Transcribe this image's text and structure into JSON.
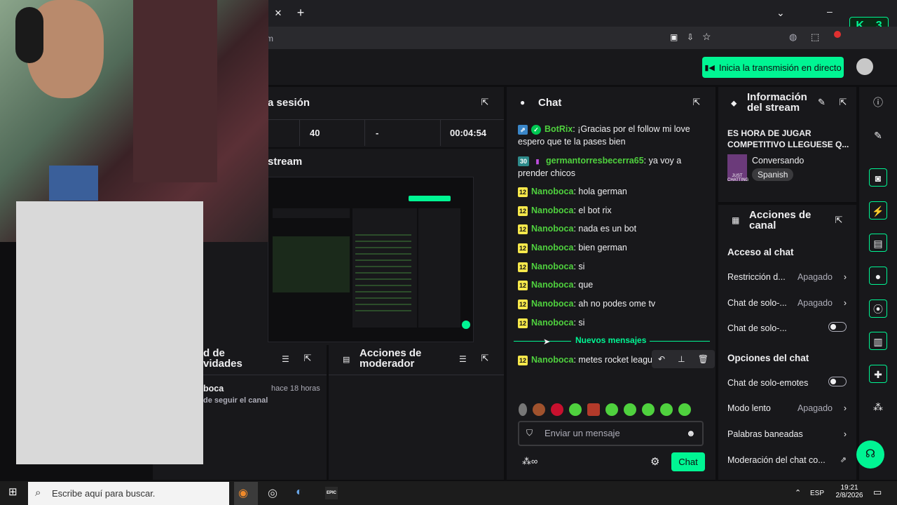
{
  "browser": {
    "address_text": "m",
    "live_button": "Inicia la transmisión en directo",
    "kbadge_letter": "K",
    "kbadge_count": "3"
  },
  "session": {
    "title": "a sesión",
    "stat_viewers": "40",
    "stat_dash": "-",
    "stat_time": "00:04:54"
  },
  "preview": {
    "title": "stream"
  },
  "activity": {
    "title_line1": "d de",
    "title_line2": "vidades",
    "user": "boca",
    "time": "hace 18 horas",
    "detail": "de seguir el canal"
  },
  "modactions": {
    "title_line1": "Acciones de",
    "title_line2": "moderador"
  },
  "chat": {
    "title": "Chat",
    "messages": [
      {
        "badge": "",
        "user": "BotRix",
        "text": "¡Gracias por el follow mi love espero que te la pases bien"
      },
      {
        "badge": "30",
        "user": "germantorresbecerra65",
        "text": "ya voy a prender chicos"
      },
      {
        "badge": "12",
        "user": "Nanoboca",
        "text": "hola german"
      },
      {
        "badge": "12",
        "user": "Nanoboca",
        "text": "el bot rix"
      },
      {
        "badge": "12",
        "user": "Nanoboca",
        "text": "nada es un bot"
      },
      {
        "badge": "12",
        "user": "Nanoboca",
        "text": "bien german"
      },
      {
        "badge": "12",
        "user": "Nanoboca",
        "text": "si"
      },
      {
        "badge": "12",
        "user": "Nanoboca",
        "text": "que"
      },
      {
        "badge": "12",
        "user": "Nanoboca",
        "text": "ah no podes ome tv"
      },
      {
        "badge": "12",
        "user": "Nanoboca",
        "text": "si"
      },
      {
        "badge": "12",
        "user": "Nanoboca",
        "text": "metes rocket league"
      }
    ],
    "new_messages": "Nuevos mensajes",
    "input_placeholder": "Enviar un mensaje",
    "send_label": "Chat"
  },
  "info": {
    "title_line1": "Información",
    "title_line2": "del stream",
    "stream_title_line1": "ES HORA DE JUGAR",
    "stream_title_line2": "COMPETITIVO LLEGUESE Q...",
    "category": "Conversando",
    "category_thumb": "JUST CHATTING",
    "language": "Spanish"
  },
  "channel_actions": {
    "title_line1": "Acciones de",
    "title_line2": "canal",
    "section1": "Acceso al chat",
    "r1_label": "Restricción d...",
    "r1_value": "Apagado",
    "r2_label": "Chat de solo-...",
    "r2_value": "Apagado",
    "r3_label": "Chat de solo-...",
    "section2": "Opciones del chat",
    "r4_label": "Chat de solo-emotes",
    "r5_label": "Modo lento",
    "r5_value": "Apagado",
    "r6_label": "Palabras baneadas",
    "r7_label": "Moderación del chat co..."
  },
  "taskbar": {
    "search_placeholder": "Escribe aquí para buscar.",
    "epic_label": "EPIC",
    "lang": "ESP",
    "time": "19:21",
    "date": "2/8/2026"
  }
}
